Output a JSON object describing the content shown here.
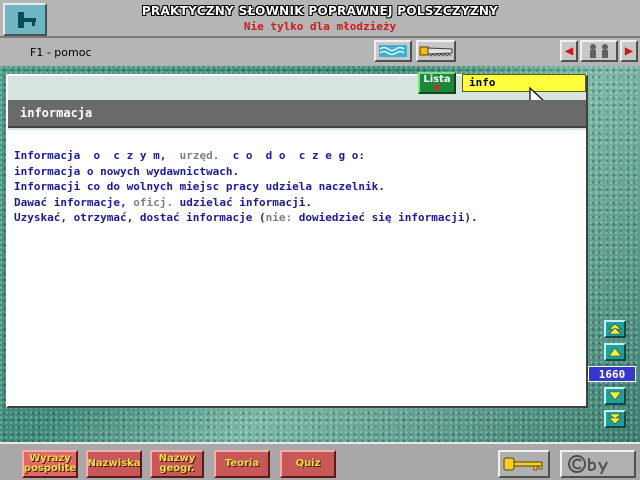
{
  "header": {
    "title": "PRAKTYCZNY SŁOWNIK POPRAWNEJ POLSZCZYZNY",
    "subtitle": "Nie tylko dla młodzieży",
    "exit_icon": "door-exit-icon"
  },
  "toolbar": {
    "help_label": "F1 - pomoc",
    "buttons": [
      "water-icon",
      "saw-icon",
      "back-arrow-icon",
      "figures-icon",
      "forward-arrow-icon"
    ]
  },
  "search": {
    "list_label": "Lista",
    "value": "info"
  },
  "entry": {
    "headword": "informacja",
    "lines": [
      [
        {
          "t": "Informacja  o  c z y m,  "
        },
        {
          "t": "urzęd.",
          "g": true
        },
        {
          "t": "  c o  d o  c z e g o:"
        }
      ],
      [
        {
          "t": "informacja o nowych wydawnictwach."
        }
      ],
      [
        {
          "t": "Informacji co do wolnych miejsc pracy udziela naczelnik."
        }
      ],
      [
        {
          "t": "Dawać informacje, "
        },
        {
          "t": "oficj.",
          "g": true
        },
        {
          "t": " udzielać informacji."
        }
      ],
      [
        {
          "t": "Uzyskać, otrzymać, dostać informacje ("
        },
        {
          "t": "nie:",
          "g": true
        },
        {
          "t": " dowiedzieć się informacji)."
        }
      ]
    ]
  },
  "scroll": {
    "counter": "1660"
  },
  "categories": [
    {
      "label": "Wyrazy\npospolite",
      "active": true
    },
    {
      "label": "Nazwiska"
    },
    {
      "label": "Nazwy\ngeogr."
    },
    {
      "label": "Teoria"
    },
    {
      "label": "Quiz"
    }
  ],
  "bottom_icons": [
    "key-icon",
    "copyright-icon"
  ],
  "colors": {
    "entry_text": "#1a1aa0",
    "subtitle": "#d01818",
    "search_bg": "#ffff40",
    "counter_bg": "#3535d0"
  }
}
